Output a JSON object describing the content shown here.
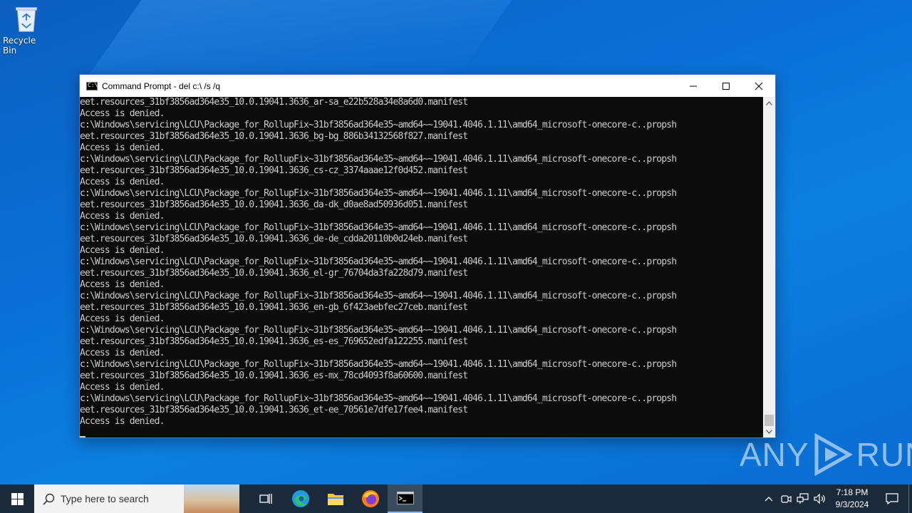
{
  "desktop": {
    "recycle_bin_label": "Recycle Bin"
  },
  "window": {
    "title": "Command Prompt - del  c:\\ /s /q",
    "console_lines": [
      "eet.resources_31bf3856ad364e35_10.0.19041.3636_ar-sa_e22b528a34e8a6d0.manifest",
      "Access is denied.",
      "c:\\Windows\\servicing\\LCU\\Package_for_RollupFix~31bf3856ad364e35~amd64~~19041.4046.1.11\\amd64_microsoft-onecore-c..propsh",
      "eet.resources_31bf3856ad364e35_10.0.19041.3636_bg-bg_886b34132568f827.manifest",
      "Access is denied.",
      "c:\\Windows\\servicing\\LCU\\Package_for_RollupFix~31bf3856ad364e35~amd64~~19041.4046.1.11\\amd64_microsoft-onecore-c..propsh",
      "eet.resources_31bf3856ad364e35_10.0.19041.3636_cs-cz_3374aaae12f0d452.manifest",
      "Access is denied.",
      "c:\\Windows\\servicing\\LCU\\Package_for_RollupFix~31bf3856ad364e35~amd64~~19041.4046.1.11\\amd64_microsoft-onecore-c..propsh",
      "eet.resources_31bf3856ad364e35_10.0.19041.3636_da-dk_d0ae8ad50936d051.manifest",
      "Access is denied.",
      "c:\\Windows\\servicing\\LCU\\Package_for_RollupFix~31bf3856ad364e35~amd64~~19041.4046.1.11\\amd64_microsoft-onecore-c..propsh",
      "eet.resources_31bf3856ad364e35_10.0.19041.3636_de-de_cdda20110b0d24eb.manifest",
      "Access is denied.",
      "c:\\Windows\\servicing\\LCU\\Package_for_RollupFix~31bf3856ad364e35~amd64~~19041.4046.1.11\\amd64_microsoft-onecore-c..propsh",
      "eet.resources_31bf3856ad364e35_10.0.19041.3636_el-gr_76704da3fa228d79.manifest",
      "Access is denied.",
      "c:\\Windows\\servicing\\LCU\\Package_for_RollupFix~31bf3856ad364e35~amd64~~19041.4046.1.11\\amd64_microsoft-onecore-c..propsh",
      "eet.resources_31bf3856ad364e35_10.0.19041.3636_en-gb_6f423aebfec27ceb.manifest",
      "Access is denied.",
      "c:\\Windows\\servicing\\LCU\\Package_for_RollupFix~31bf3856ad364e35~amd64~~19041.4046.1.11\\amd64_microsoft-onecore-c..propsh",
      "eet.resources_31bf3856ad364e35_10.0.19041.3636_es-es_769652edfa122255.manifest",
      "Access is denied.",
      "c:\\Windows\\servicing\\LCU\\Package_for_RollupFix~31bf3856ad364e35~amd64~~19041.4046.1.11\\amd64_microsoft-onecore-c..propsh",
      "eet.resources_31bf3856ad364e35_10.0.19041.3636_es-mx_78cd4093f8a60600.manifest",
      "Access is denied.",
      "c:\\Windows\\servicing\\LCU\\Package_for_RollupFix~31bf3856ad364e35~amd64~~19041.4046.1.11\\amd64_microsoft-onecore-c..propsh",
      "eet.resources_31bf3856ad364e35_10.0.19041.3636_et-ee_70561e7dfe17fee4.manifest",
      "Access is denied."
    ]
  },
  "watermark": {
    "left": "ANY",
    "right": "RUN"
  },
  "taskbar": {
    "search_placeholder": "Type here to search",
    "time": "7:18 PM",
    "date": "9/3/2024"
  },
  "colors": {
    "console_bg": "#0c0c0c",
    "console_fg": "#cccccc",
    "taskbar_bg": "#1b2a3b",
    "desktop_blue": "#0a6fd6"
  }
}
